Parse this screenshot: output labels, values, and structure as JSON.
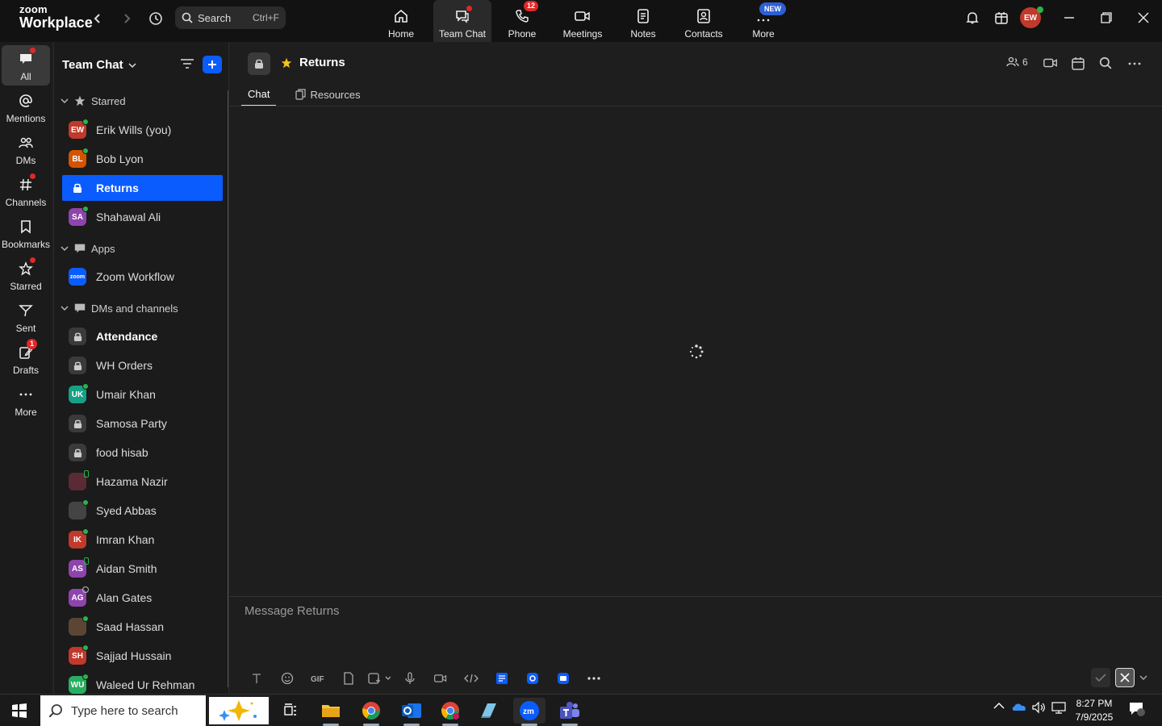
{
  "brand": {
    "line1": "zoom",
    "line2": "Workplace"
  },
  "search": {
    "label": "Search",
    "shortcut": "Ctrl+F"
  },
  "topnav": [
    {
      "label": "Home"
    },
    {
      "label": "Team Chat"
    },
    {
      "label": "Phone",
      "badge": "12"
    },
    {
      "label": "Meetings"
    },
    {
      "label": "Notes"
    },
    {
      "label": "Contacts"
    },
    {
      "label": "More",
      "badge": "NEW"
    }
  ],
  "user_avatar": "EW",
  "rail": [
    {
      "label": "All"
    },
    {
      "label": "Mentions"
    },
    {
      "label": "DMs"
    },
    {
      "label": "Channels"
    },
    {
      "label": "Bookmarks"
    },
    {
      "label": "Starred"
    },
    {
      "label": "Sent"
    },
    {
      "label": "Drafts",
      "badge": "1"
    },
    {
      "label": "More"
    }
  ],
  "sidebar": {
    "title": "Team Chat",
    "sections": {
      "starred": "Starred",
      "apps": "Apps",
      "dms": "DMs and channels"
    },
    "starred": [
      {
        "initials": "EW",
        "name": "Erik Wills (you)",
        "color": "#c0392b"
      },
      {
        "initials": "BL",
        "name": "Bob Lyon",
        "color": "#d35400"
      },
      {
        "name": "Returns"
      },
      {
        "initials": "SA",
        "name": "Shahawal Ali",
        "color": "#8e44ad"
      }
    ],
    "apps": [
      {
        "initials": "zoom",
        "name": "Zoom Workflow",
        "color": "#0b5cff"
      }
    ],
    "dms": [
      {
        "name": "Attendance"
      },
      {
        "name": "WH Orders"
      },
      {
        "initials": "UK",
        "name": "Umair Khan",
        "color": "#16a085"
      },
      {
        "name": "Samosa Party"
      },
      {
        "name": "food hisab"
      },
      {
        "initials": "",
        "name": "Hazama Nazir",
        "color": "#5a2a35"
      },
      {
        "initials": "",
        "name": "Syed Abbas",
        "color": "#444444"
      },
      {
        "initials": "IK",
        "name": "Imran Khan",
        "color": "#c0392b"
      },
      {
        "initials": "AS",
        "name": "Aidan Smith",
        "color": "#8e44ad"
      },
      {
        "initials": "AG",
        "name": "Alan Gates",
        "color": "#8e44ad"
      },
      {
        "initials": "",
        "name": "Saad Hassan",
        "color": "#5b4636"
      },
      {
        "initials": "SH",
        "name": "Sajjad Hussain",
        "color": "#c0392b"
      },
      {
        "initials": "WU",
        "name": "Waleed Ur Rehman",
        "color": "#27ae60"
      }
    ]
  },
  "channel": {
    "name": "Returns",
    "members": "6",
    "tabs": [
      "Chat",
      "Resources"
    ],
    "compose_placeholder": "Message Returns"
  },
  "taskbar": {
    "search_placeholder": "Type here to search",
    "time": "8:27 PM",
    "date": "7/9/2025"
  }
}
